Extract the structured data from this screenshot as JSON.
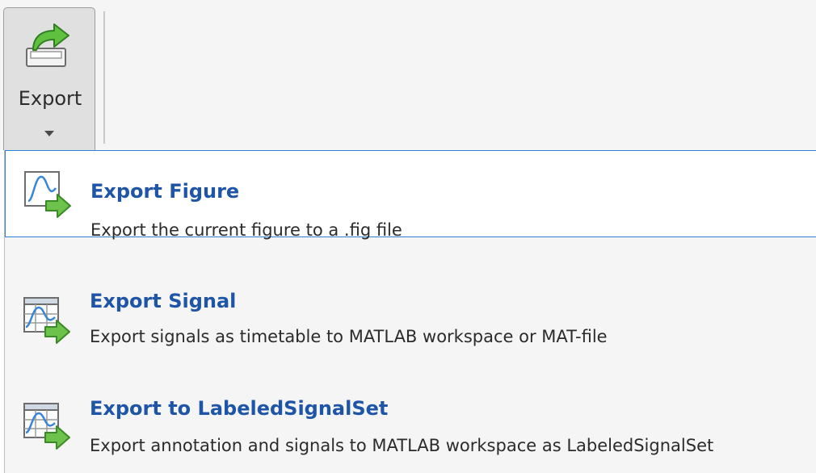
{
  "toolstrip": {
    "export_button": {
      "label": "Export",
      "icon": "export-arrow-icon"
    }
  },
  "menu": {
    "items": [
      {
        "title": "Export Figure",
        "description": "Export the current figure to a .fig file",
        "icon": "export-figure-icon",
        "selected": true
      },
      {
        "title": "Export Signal",
        "description": "Export signals as timetable to MATLAB workspace or MAT-file",
        "icon": "export-signal-icon",
        "selected": false
      },
      {
        "title": "Export to LabeledSignalSet",
        "description": "Export annotation and signals to MATLAB workspace as LabeledSignalSet",
        "icon": "export-labeled-signal-set-icon",
        "selected": false
      }
    ]
  },
  "colors": {
    "accent": "#2d7fd4",
    "title": "#1e55a6",
    "arrow_green": "#4caf3a"
  }
}
